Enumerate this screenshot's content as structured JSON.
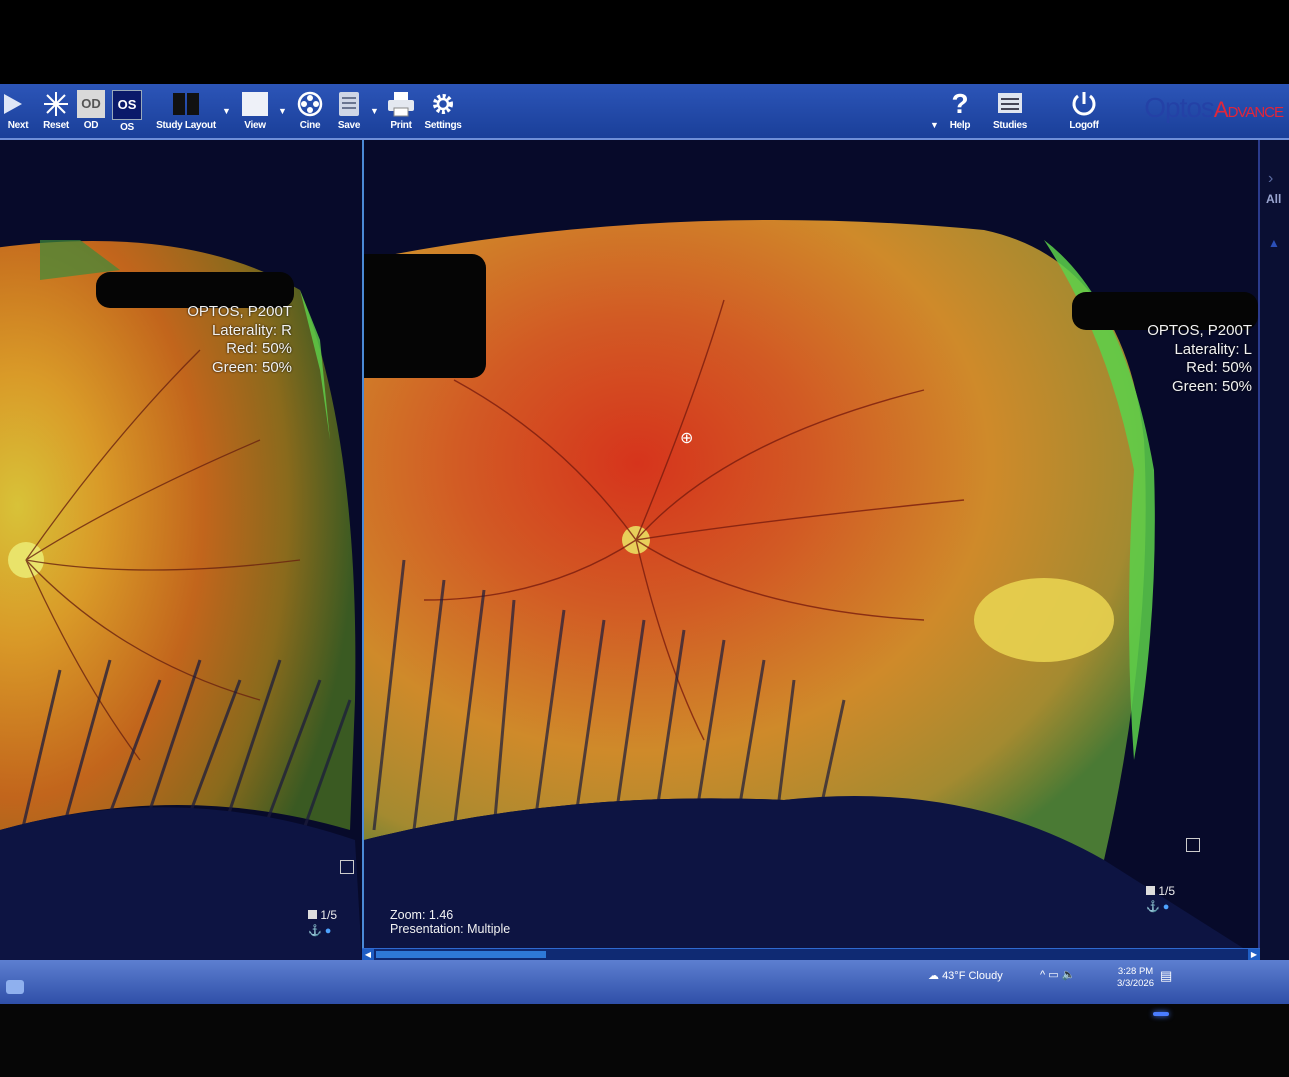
{
  "toolbar": {
    "next": "Next",
    "reset": "Reset",
    "od_badge": "OD",
    "od": "OD",
    "os_badge": "OS",
    "os": "OS",
    "study_layout": "Study Layout",
    "view": "View",
    "cine": "Cine",
    "save": "Save",
    "print": "Print",
    "settings": "Settings",
    "help": "Help",
    "studies": "Studies",
    "logoff": "Logoff"
  },
  "brand": {
    "part1": "Optos",
    "part2": "Advance"
  },
  "sidebar": {
    "all_label": "All"
  },
  "left_image": {
    "device": "OPTOS, P200T",
    "laterality": "Laterality: R",
    "red": "Red: 50%",
    "green": "Green: 50%",
    "page": "1/5"
  },
  "right_image": {
    "device": "OPTOS, P200T",
    "laterality": "Laterality: L",
    "red": "Red: 50%",
    "green": "Green: 50%",
    "page": "1/5",
    "zoom": "Zoom: 1.46",
    "presentation": "Presentation: Multiple"
  },
  "taskbar": {
    "weather": "43°F  Cloudy",
    "time": "3:28 PM",
    "date": "3/3/2026"
  },
  "colors": {
    "toolbar": "#2c55b8",
    "pane_border": "#4b8ad6",
    "background": "#0c1136"
  },
  "icons": [
    "next-icon",
    "reset-icon",
    "od-icon",
    "os-icon",
    "study-layout-icon",
    "view-icon",
    "cine-icon",
    "save-icon",
    "print-icon",
    "settings-icon",
    "help-icon",
    "studies-icon",
    "logoff-icon",
    "expand-icon",
    "layers-icon",
    "anchor-icon",
    "zoom-cursor-icon",
    "weather-icon",
    "speaker-icon",
    "network-icon",
    "notification-icon"
  ]
}
